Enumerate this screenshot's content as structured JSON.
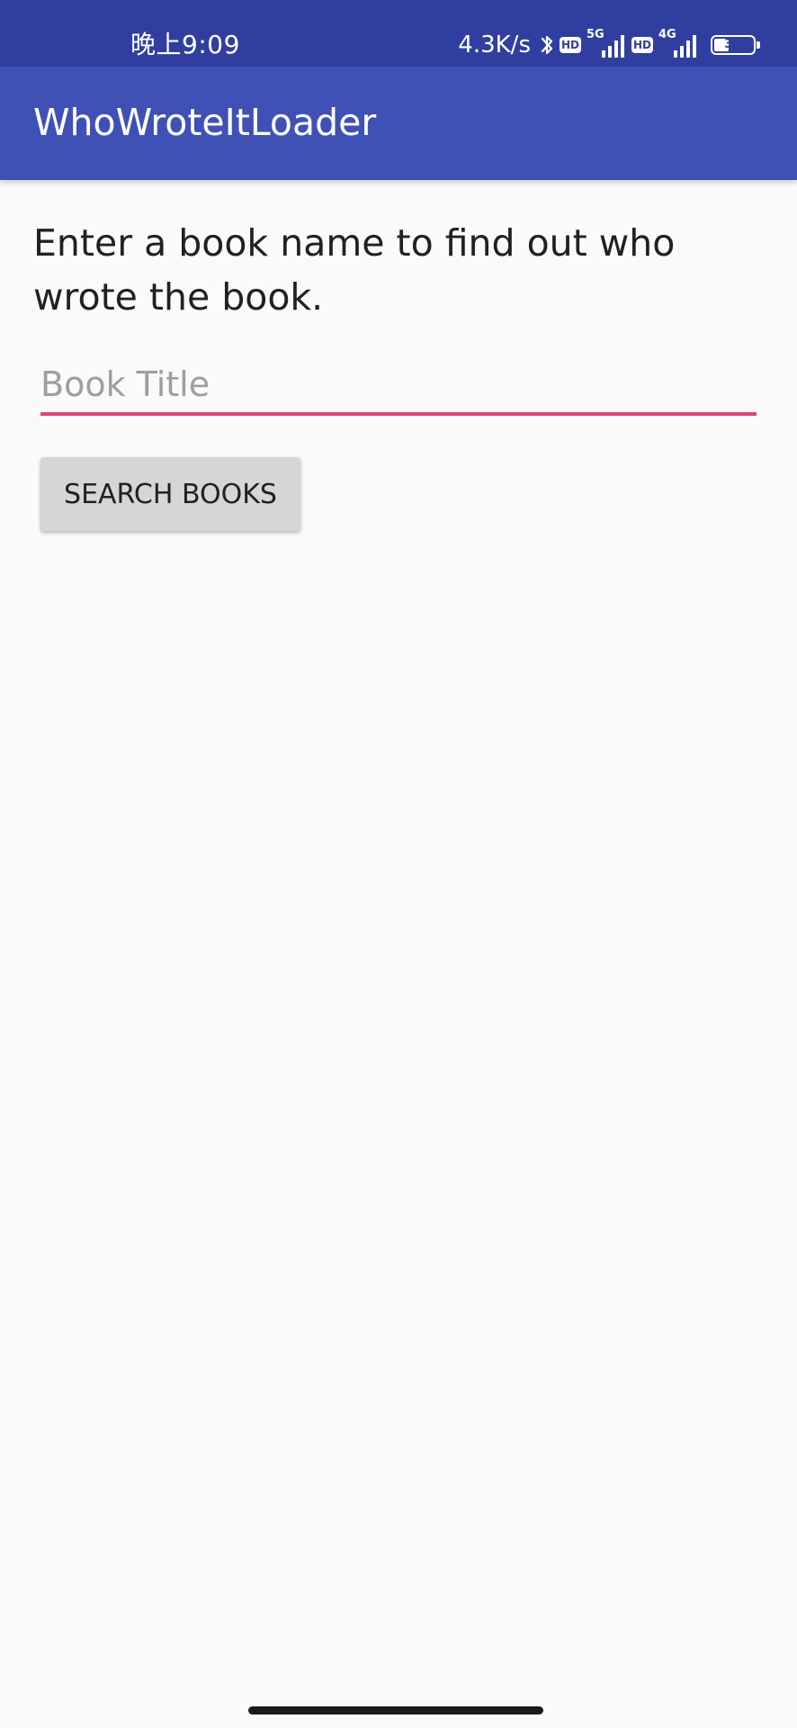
{
  "status_bar": {
    "time": "晚上9:09",
    "net_speed": "4.3K/s",
    "hd_label": "HD",
    "sim1_network": "5G",
    "sim2_network": "4G",
    "battery_level": "39",
    "battery_fraction": 0.39
  },
  "app_bar": {
    "title": "WhoWroteItLoader"
  },
  "main": {
    "instruction": "Enter a book name to find out who wrote the book.",
    "book_input": {
      "value": "",
      "placeholder": "Book Title"
    },
    "search_button_label": "SEARCH BOOKS"
  },
  "colors": {
    "status_bar": "#303f9f",
    "app_bar": "#3f51b5",
    "accent": "#e0437e",
    "background": "#fafafa",
    "button": "#d6d6d6"
  },
  "icons": {
    "bluetooth": "bluetooth-icon",
    "signal": "signal-bars-icon",
    "battery": "battery-icon"
  }
}
